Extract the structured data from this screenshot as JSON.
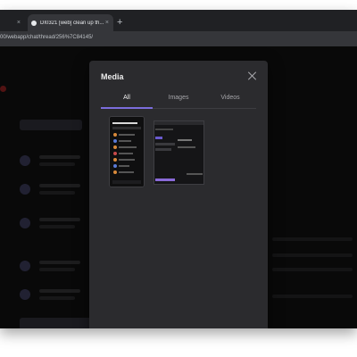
{
  "browser": {
    "tabs": [
      {
        "label": "",
        "active": false
      },
      {
        "label": "DI0321 [web] clean up th...",
        "active": true
      }
    ],
    "new_tab_symbol": "+",
    "close_symbol": "×",
    "url": "00/webapp/chat/thread/256%7C84145/"
  },
  "modal": {
    "title": "Media",
    "tabs": [
      {
        "label": "All",
        "active": true
      },
      {
        "label": "Images",
        "active": false
      },
      {
        "label": "Videos",
        "active": false
      }
    ],
    "items": [
      {
        "kind": "image",
        "icon": "phone-screenshot-thumbnail"
      },
      {
        "kind": "image",
        "icon": "desktop-screenshot-thumbnail"
      }
    ]
  },
  "colors": {
    "accent": "#7b6ddc",
    "modal_bg": "#2b2b2e",
    "browser_tabbar": "#202124"
  }
}
